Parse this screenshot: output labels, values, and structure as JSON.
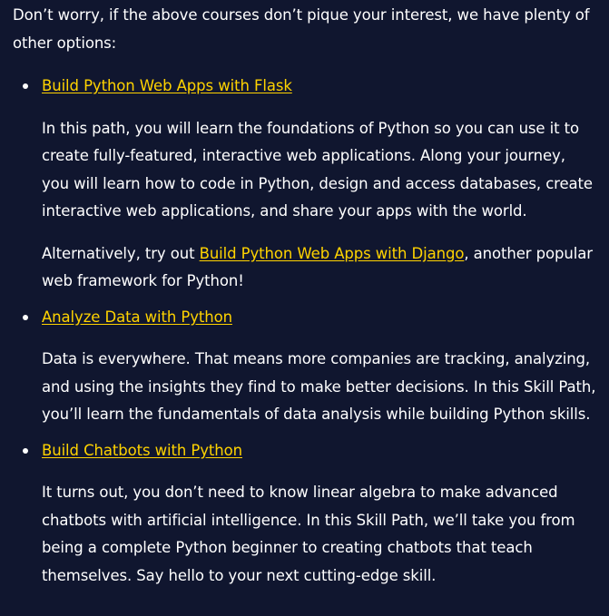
{
  "intro_text": "Don’t worry, if the above courses don’t pique your interest, we have plenty of other options:",
  "courses": [
    {
      "link_label": "Build Python Web Apps with Flask",
      "paragraphs": [
        "In this path, you will learn the foundations of Python so you can use it to create fully-featured, interactive web applications. Along your journey, you will learn how to code in Python, design and access databases, create interactive web applications, and share your apps with the world."
      ],
      "alt": {
        "prefix": "Alternatively, try out ",
        "link_label": "Build Python Web Apps with Django",
        "suffix": ", another popular web framework for Python!"
      }
    },
    {
      "link_label": "Analyze Data with Python",
      "paragraphs": [
        "Data is everywhere. That means more companies are tracking, analyzing, and using the insights they find to make better decisions. In this Skill Path, you’ll learn the fundamentals of data analysis while building Python skills."
      ]
    },
    {
      "link_label": "Build Chatbots with Python",
      "paragraphs": [
        "It turns out, you don’t need to know linear algebra to make advanced chatbots with artificial intelligence. In this Skill Path, we’ll take you from being a complete Python beginner to creating chatbots that teach themselves. Say hello to your next cutting-edge skill."
      ]
    }
  ],
  "colors": {
    "background": "#10162f",
    "text": "#ffffff",
    "link": "#ffd300"
  }
}
